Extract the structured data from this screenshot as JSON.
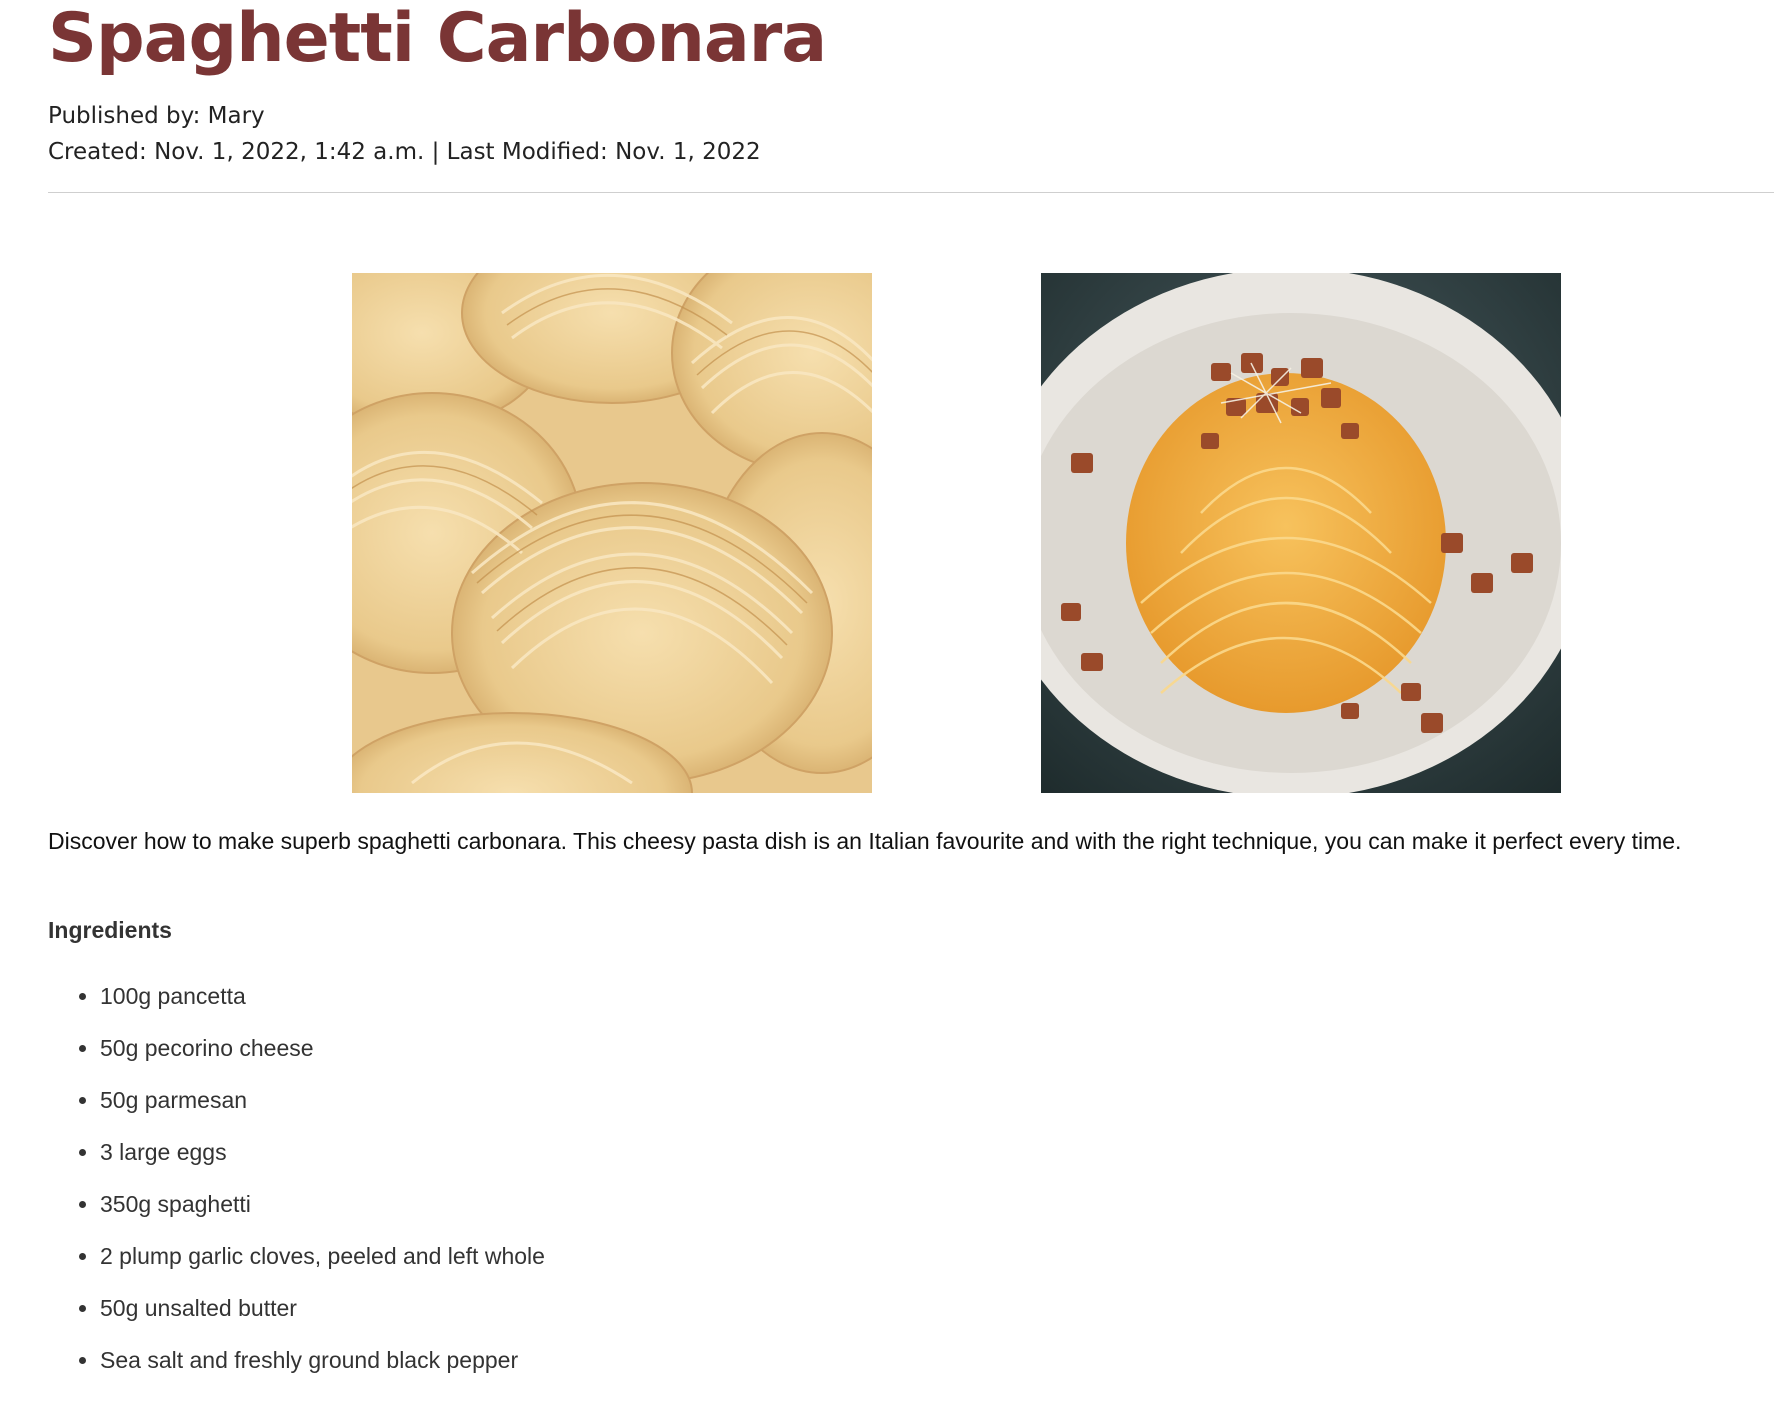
{
  "recipe": {
    "title": "Spaghetti Carbonara",
    "published_by": "Published by: Mary",
    "dates": "Created: Nov. 1, 2022, 1:42 a.m. | Last Modified: Nov. 1, 2022",
    "intro": "Discover how to make superb spaghetti carbonara. This cheesy pasta dish is an Italian favourite and with the right technique, you can make it perfect every time.",
    "ingredients_heading": "Ingredients",
    "ingredients": [
      "100g pancetta",
      "50g pecorino cheese",
      "50g parmesan",
      "3 large eggs",
      "350g spaghetti",
      "2 plump garlic cloves, peeled and left whole",
      "50g unsalted butter",
      "Sea salt and freshly ground black pepper"
    ]
  },
  "colors": {
    "title": "#7a3535",
    "text": "#222222",
    "divider": "#cfcfcf"
  }
}
